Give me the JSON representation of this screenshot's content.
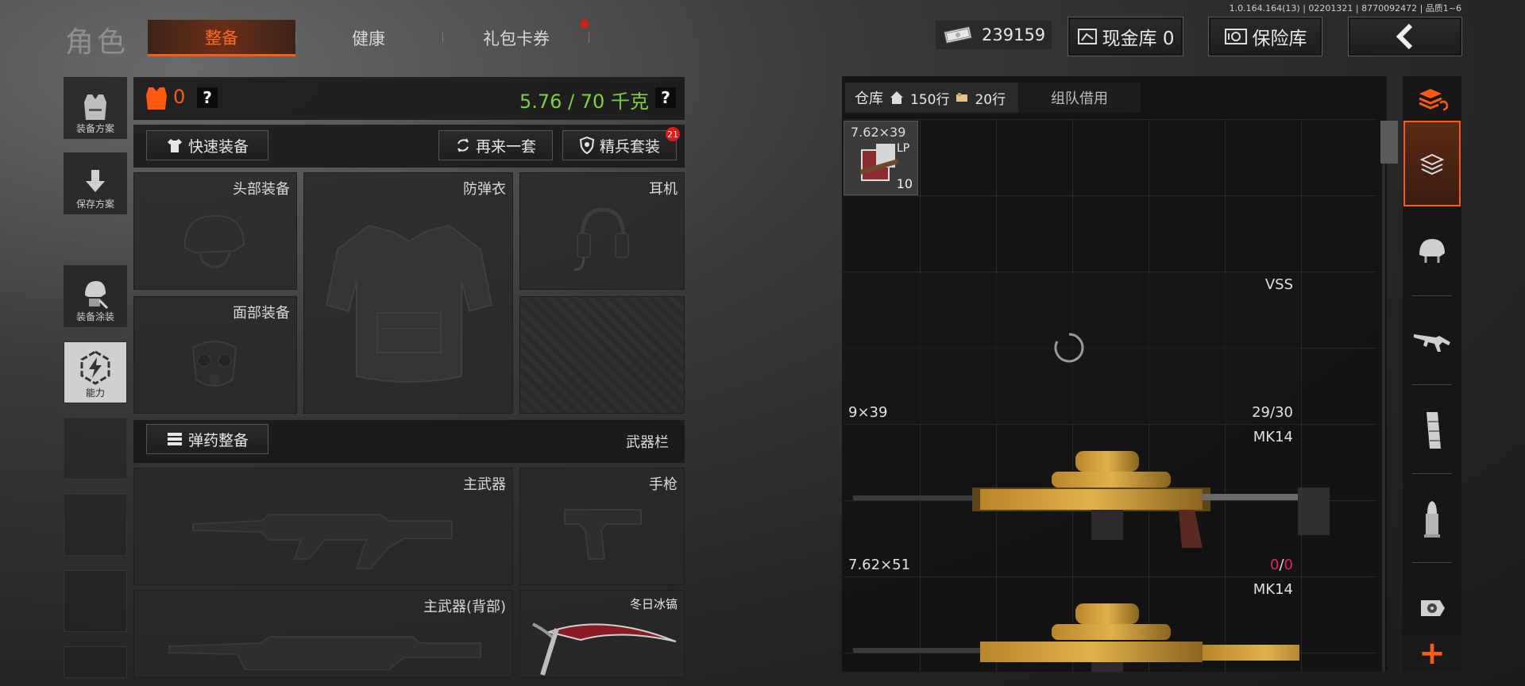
{
  "version": "1.0.164.164(13) | 02201321 | 8770092472 | 品质1~6",
  "header": {
    "title": "角色",
    "tabs": [
      {
        "label": "整备",
        "active": true
      },
      {
        "label": "健康",
        "active": false
      },
      {
        "label": "礼包卡券",
        "active": false,
        "has_notification": true
      }
    ],
    "money": "239159",
    "cash_vault": "现金库 0",
    "safe": "保险库",
    "back_icon": "chevron-left-icon"
  },
  "sidebar": {
    "items": [
      {
        "label": "装备方案",
        "icon": "vest-icon"
      },
      {
        "label": "保存方案",
        "icon": "download-icon"
      },
      {
        "label": "装备涂装",
        "icon": "helmet-paint-icon"
      },
      {
        "label": "能力",
        "icon": "bolt-hexagon-icon",
        "active": true
      }
    ]
  },
  "loadout": {
    "armor_count": "0",
    "help": "?",
    "weight": "5.76 / 70 千克",
    "quick_equip": "快速装备",
    "reroll": "再来一套",
    "elite_suit": "精兵套装",
    "elite_badge": "21",
    "slots": {
      "head": "头部装备",
      "armor": "防弹衣",
      "headset": "耳机",
      "face": "面部装备"
    },
    "ammo_button": "弹药整备",
    "weapon_bar": "武器栏",
    "primary": "主武器",
    "pistol": "手枪",
    "primary_back": "主武器(背部)",
    "melee_name": "冬日冰镐"
  },
  "inventory": {
    "tab_storage": "仓库",
    "storage_rows": "150行",
    "ammo_rows": "20行",
    "tab_team": "组队借用",
    "ammo_item": {
      "caliber": "7.62×39",
      "tag": "LP",
      "count": "10"
    },
    "weapons": [
      {
        "name": "VSS",
        "caliber": "9×39",
        "ammo_loaded": "29",
        "ammo_capacity": "30"
      },
      {
        "name": "MK14",
        "caliber": "7.62×51",
        "ammo_loaded": "0",
        "ammo_capacity": "0"
      },
      {
        "name": "MK14",
        "caliber": "",
        "ammo_loaded": "",
        "ammo_capacity": ""
      }
    ]
  },
  "filters": {
    "items": [
      "all-items-icon",
      "layers-icon",
      "helmet-icon",
      "rifle-icon",
      "magazine-icon",
      "bullet-icon",
      "sight-icon"
    ],
    "add_label": "+"
  },
  "colors": {
    "accent": "#ff5a10",
    "weight_green": "#7ed13b",
    "badge_red": "#e01818"
  }
}
